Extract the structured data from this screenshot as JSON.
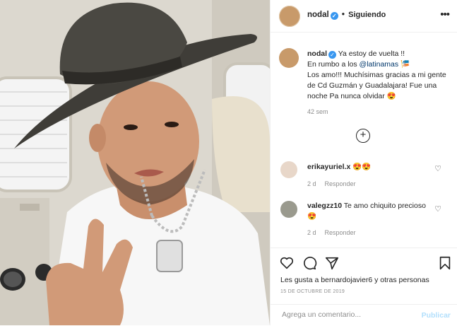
{
  "header": {
    "username": "nodal",
    "verified_glyph": "✓",
    "separator": "•",
    "follow_status": "Siguiendo",
    "more_icon": "•••"
  },
  "caption": {
    "username": "nodal",
    "line1": "Ya estoy de vuelta !!",
    "line2_prefix": "En rumbo a los ",
    "mention": "@latinamas",
    "line2_emoji": "🎏",
    "line3": "Los amo!!! Muchísimas gracias a mi gente de Cd Guzmán y Guadalajara! Fue una noche Pa nunca olvidar",
    "line3_emoji": "😍",
    "time": "42 sem"
  },
  "load_more_icon": "+",
  "comments": [
    {
      "username": "erikayuriel.x",
      "text": "😍😍",
      "age": "2 d",
      "reply": "Responder"
    },
    {
      "username": "valegzz10",
      "text": "Te amo chiquito precioso 😍",
      "age": "2 d",
      "reply": "Responder"
    }
  ],
  "actions": {
    "likes_text": "Les gusta a bernardojavier6 y otras personas",
    "date": "15 DE OCTUBRE DE 2019"
  },
  "add_comment": {
    "placeholder": "Agrega un comentario...",
    "publish": "Publicar"
  },
  "icons": [
    "heart-icon",
    "comment-icon",
    "share-icon",
    "bookmark-icon",
    "like-comment-icon",
    "plus-circle-icon"
  ],
  "colors": {
    "link": "#00376b",
    "verified": "#3897f0",
    "publish_disabled": "#b2dffc",
    "muted": "#8e8e8e"
  }
}
